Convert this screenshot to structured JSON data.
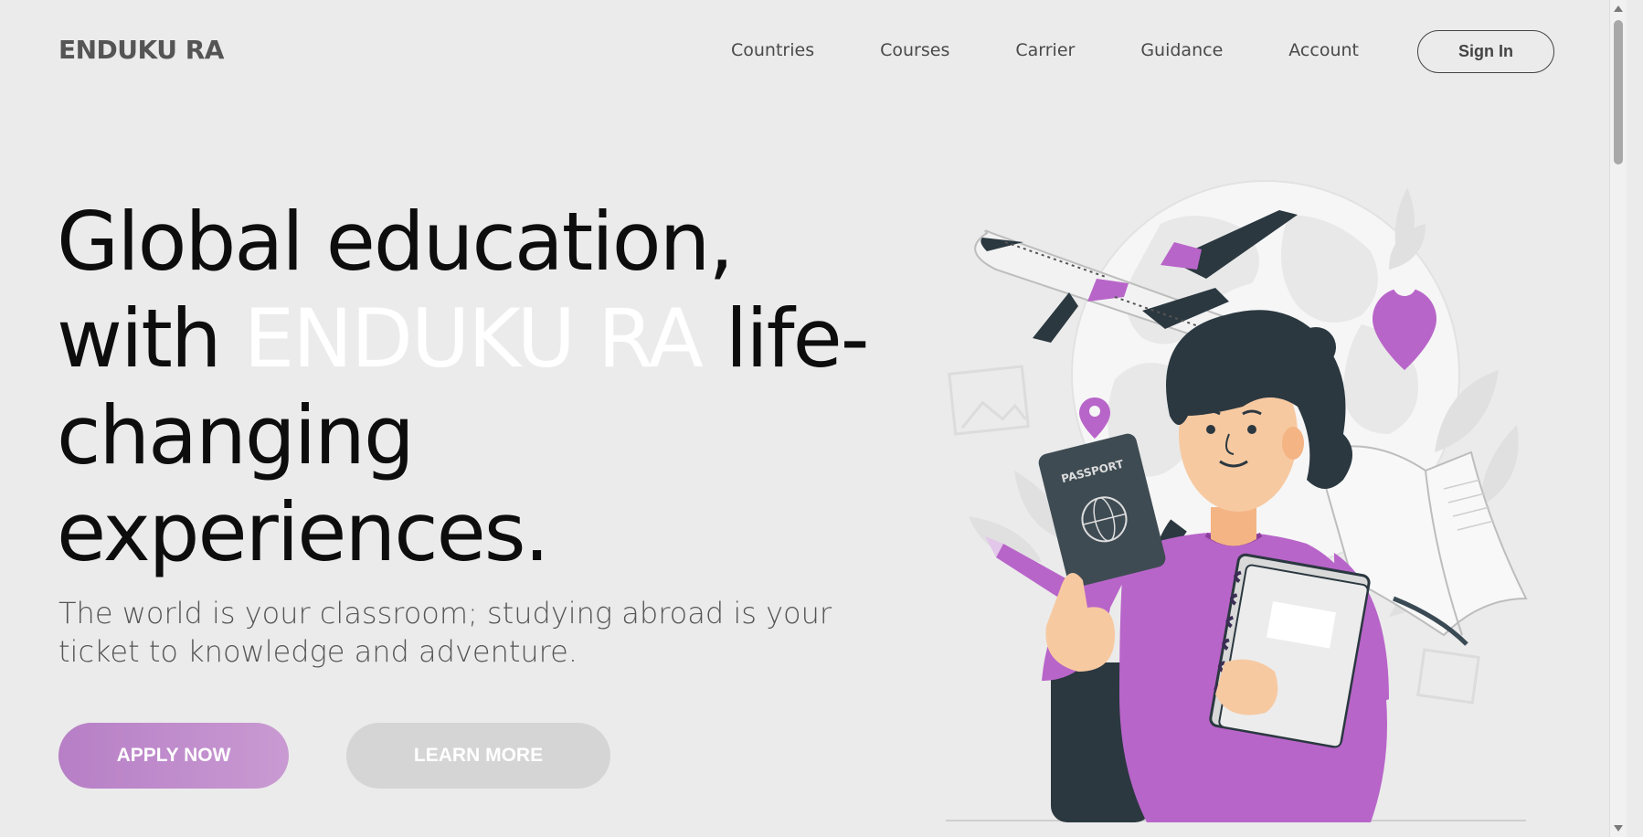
{
  "header": {
    "brand": "ENDUKU RA",
    "nav": [
      "Countries",
      "Courses",
      "Carrier",
      "Guidance",
      "Account"
    ],
    "signin_label": "Sign In"
  },
  "hero": {
    "title_line1": "Global education,",
    "title_with": "with ",
    "title_accent": "ENDUKU RA",
    "title_rest1": " life-",
    "title_line3": "changing",
    "title_line4": "experiences.",
    "subtitle": "The world is your classroom; studying abroad is your ticket to knowledge and adventure.",
    "apply_label": "APPLY NOW",
    "learn_label": "LEARN MORE",
    "passport_text": "PASSPORT"
  },
  "colors": {
    "accent": "#b865c9",
    "background": "#ebebeb",
    "apply_button": "#bd88ca",
    "learn_button": "#d5d5d5"
  },
  "icons": [
    "airplane-icon",
    "location-pin-icon",
    "passport-icon",
    "globe-icon",
    "book-icon",
    "notebook-icon",
    "pencil-icon",
    "backpack-icon",
    "leaf-icon",
    "image-placeholder-icon"
  ]
}
